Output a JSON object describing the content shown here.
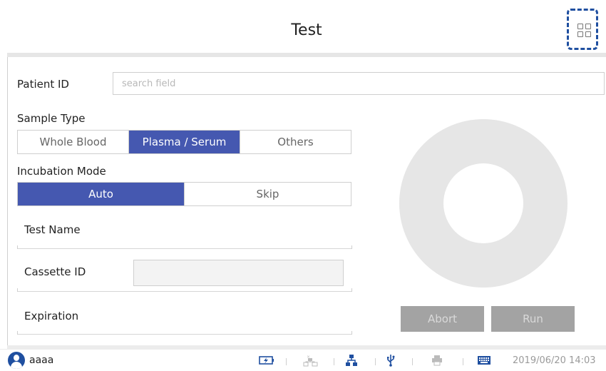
{
  "header": {
    "title": "Test",
    "apps_icon": "grid-icon"
  },
  "patient": {
    "label": "Patient ID",
    "placeholder": "search field",
    "value": ""
  },
  "sample_type": {
    "label": "Sample Type",
    "options": [
      "Whole Blood",
      "Plasma / Serum",
      "Others"
    ],
    "selected": "Plasma / Serum"
  },
  "incubation_mode": {
    "label": "Incubation Mode",
    "options": [
      "Auto",
      "Skip"
    ],
    "selected": "Auto"
  },
  "fields": {
    "test_name": "Test Name",
    "cassette_id": "Cassette ID",
    "expiration": "Expiration"
  },
  "actions": {
    "abort": "Abort",
    "run": "Run"
  },
  "status_bar": {
    "user": "aaaa",
    "icons": [
      "battery-charging-icon",
      "lis-network-disconnected-icon",
      "network-icon",
      "usb-icon",
      "printer-disconnected-icon",
      "keyboard-icon"
    ],
    "datetime": "2019/06/20 14:03"
  },
  "colors": {
    "accent": "#4558b0",
    "highlight": "#1f4fa0",
    "disabled_button": "#a3a3a3",
    "donut": "#e6e6e6"
  }
}
